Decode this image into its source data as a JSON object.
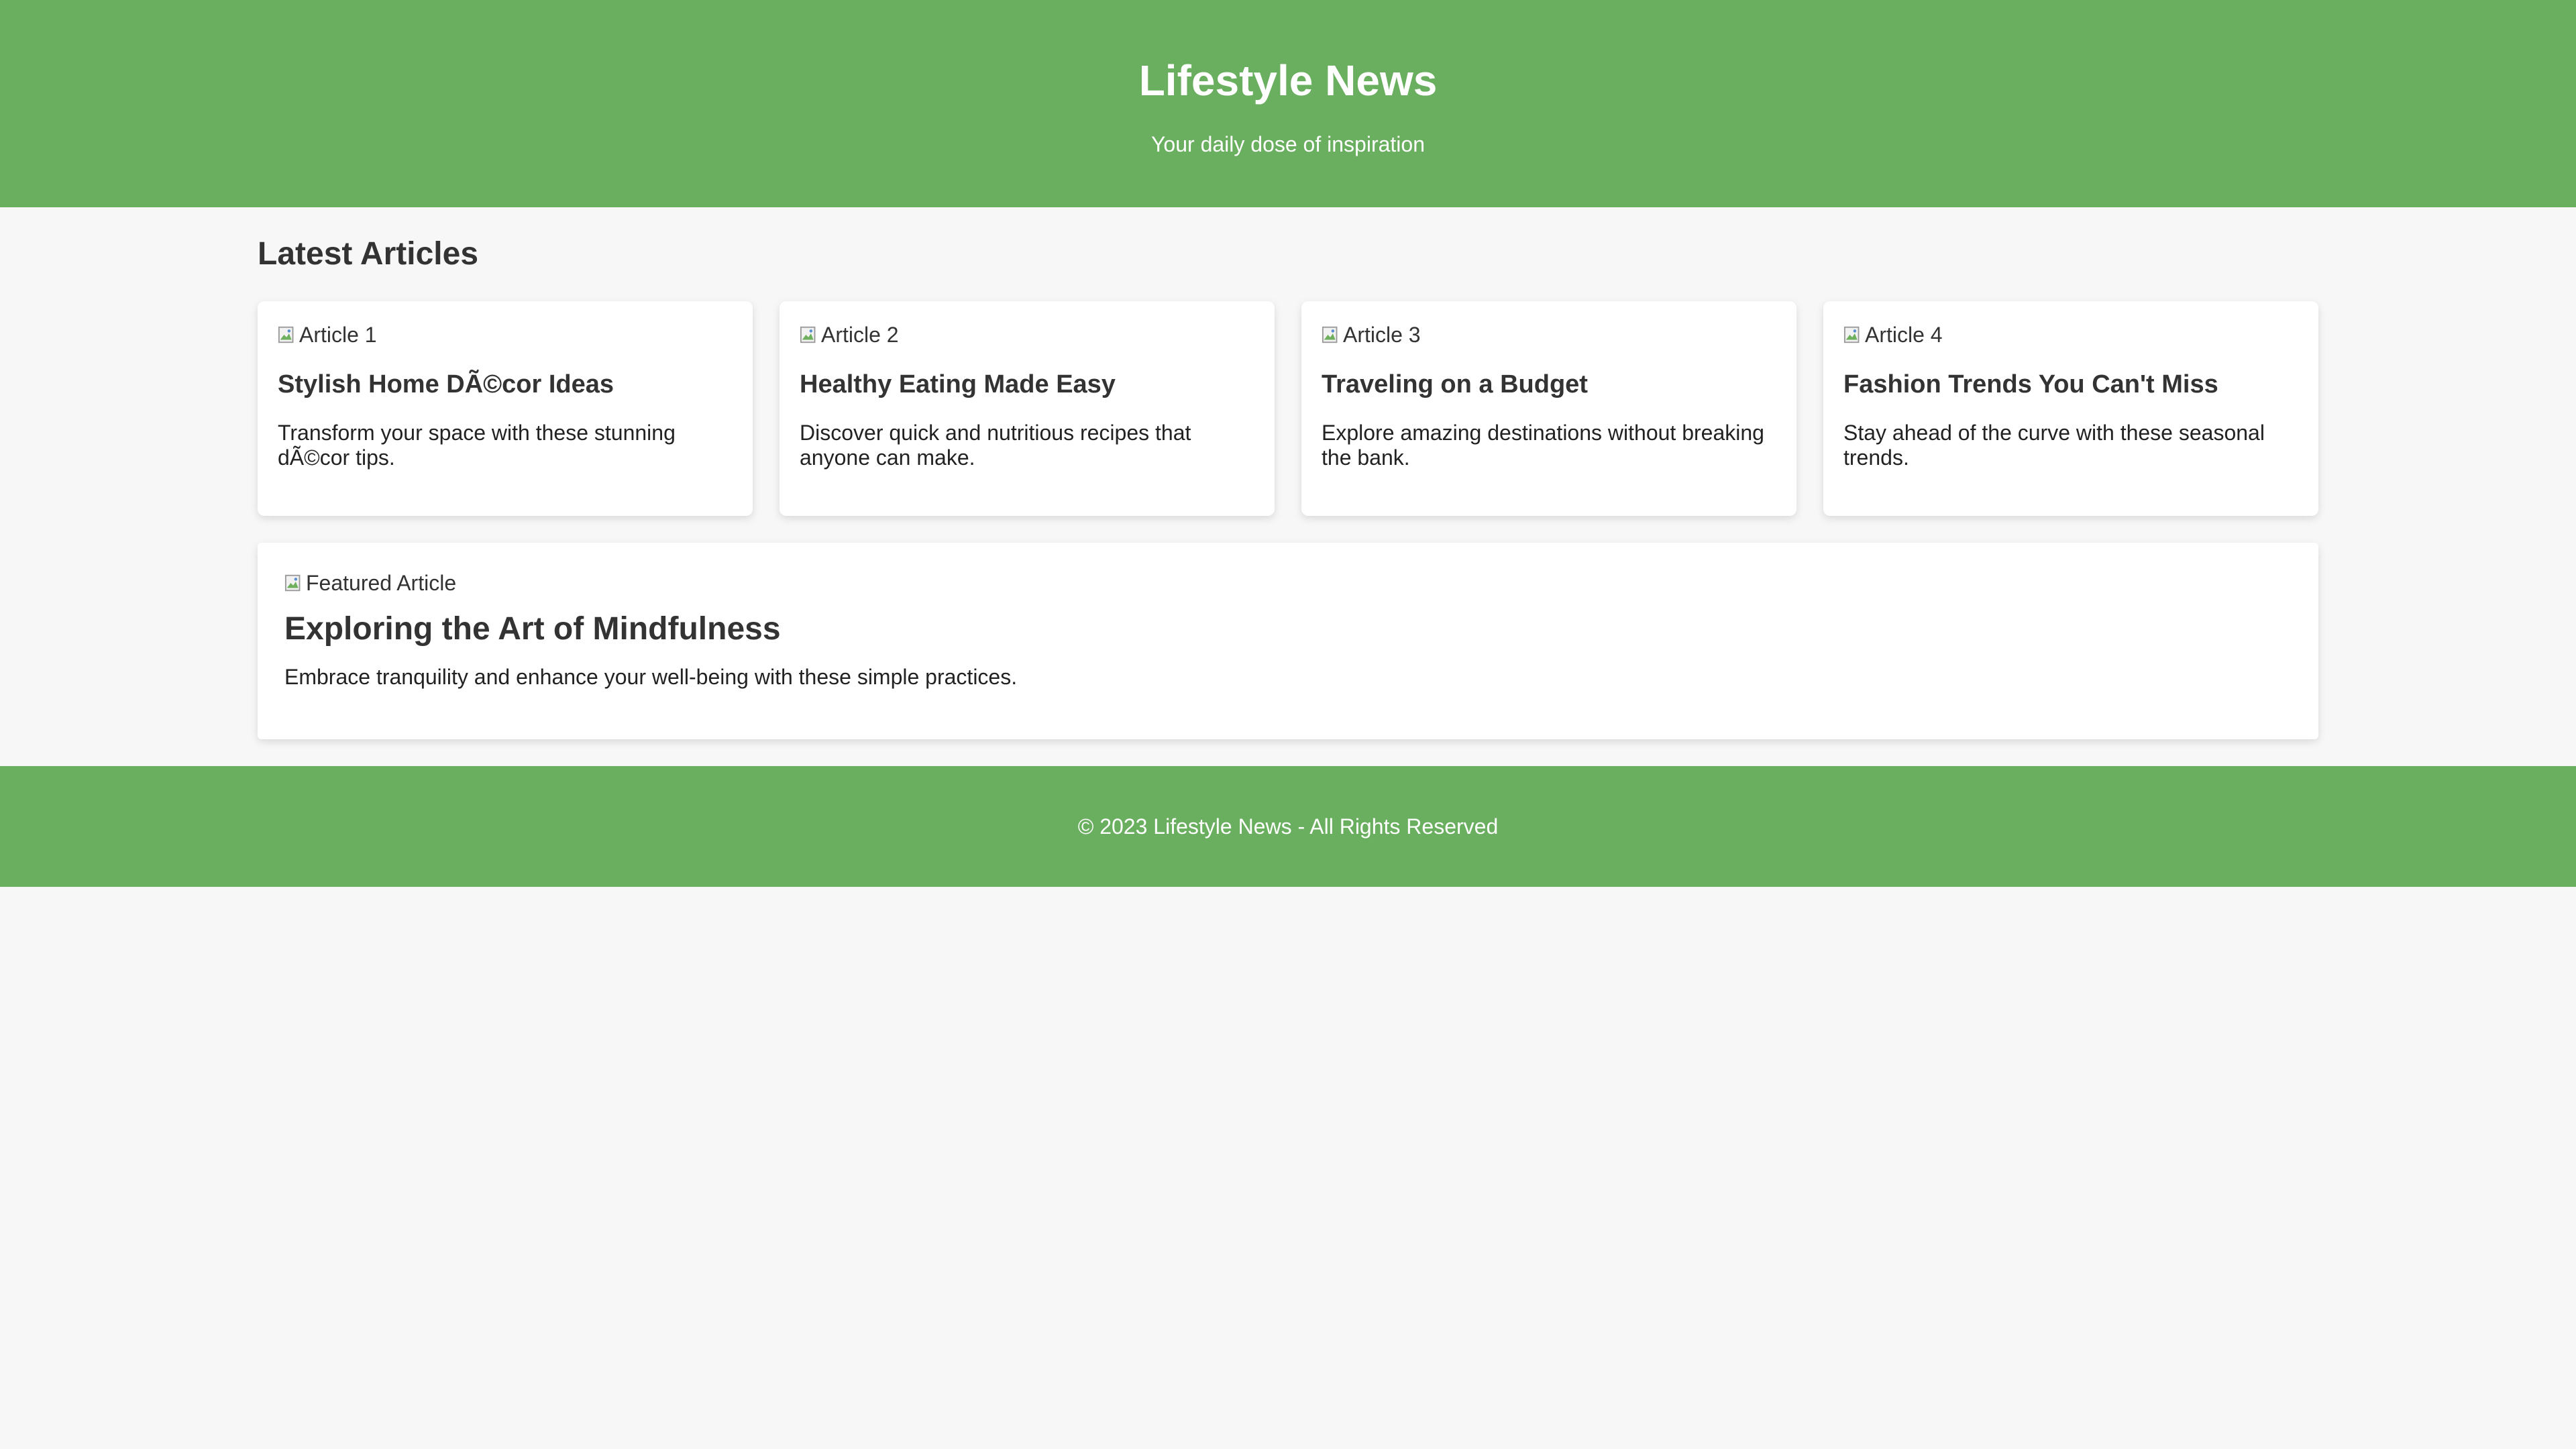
{
  "header": {
    "title": "Lifestyle News",
    "tagline": "Your daily dose of inspiration"
  },
  "main": {
    "section_title": "Latest Articles",
    "articles": [
      {
        "image_alt": "Article 1",
        "title": "Stylish Home DÃ©cor Ideas",
        "summary": "Transform your space with these stunning dÃ©cor tips."
      },
      {
        "image_alt": "Article 2",
        "title": "Healthy Eating Made Easy",
        "summary": "Discover quick and nutritious recipes that anyone can make."
      },
      {
        "image_alt": "Article 3",
        "title": "Traveling on a Budget",
        "summary": "Explore amazing destinations without breaking the bank."
      },
      {
        "image_alt": "Article 4",
        "title": "Fashion Trends You Can't Miss",
        "summary": "Stay ahead of the curve with these seasonal trends."
      }
    ],
    "featured": {
      "image_alt": "Featured Article",
      "title": "Exploring the Art of Mindfulness",
      "summary": "Embrace tranquility and enhance your well-being with these simple practices."
    }
  },
  "footer": {
    "text": "© 2023 Lifestyle News - All Rights Reserved"
  },
  "colors": {
    "brand_green": "#6aaf5f",
    "page_background": "#f7f7f7",
    "card_background": "#ffffff",
    "text_dark": "#333333"
  },
  "icons": {
    "broken_image": "broken-image-icon"
  }
}
